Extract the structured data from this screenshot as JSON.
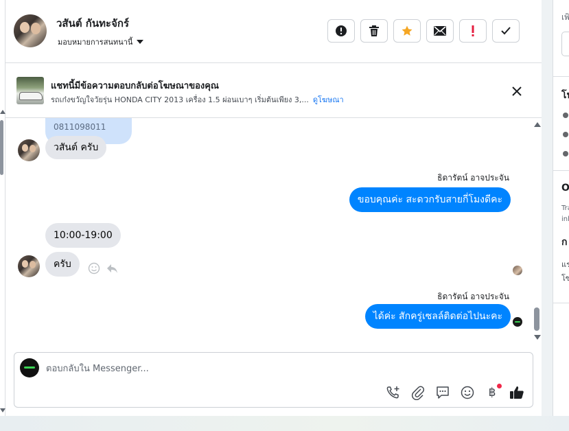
{
  "header": {
    "contact_name": "วสันต์ กันทะจักร์",
    "assign_label": "มอบหมายการสนทนานี้",
    "tools": [
      {
        "name": "spam-button",
        "icon": "alert-circle-icon"
      },
      {
        "name": "delete-button",
        "icon": "trash-icon"
      },
      {
        "name": "star-button",
        "icon": "star-icon",
        "color": "#f5a623"
      },
      {
        "name": "mark-unread-button",
        "icon": "envelope-icon"
      },
      {
        "name": "follow-up-button",
        "icon": "exclamation-icon",
        "color": "#e41e3f"
      },
      {
        "name": "done-button",
        "icon": "check-icon"
      }
    ]
  },
  "ad": {
    "title": "แชทนี้มีข้อความตอบกลับต่อโฆษณาของคุณ",
    "description": "รถเก๋งขวัญใจวัยรุ่น HONDA CITY 2013 เครื่อง 1.5 ผ่อนเบาๆ เริ่มต้นเพียง 3,...",
    "link_label": "ดูโฆษณา"
  },
  "messages": {
    "phone": "0811098011",
    "m1": "วสันต์  ครับ",
    "sender1": "ธิดารัตน์ อาจประจัน",
    "m2": "ขอบคุณค่ะ สะดวกรับสายกี่โมงดีคะ",
    "m3": "10:00-19:00",
    "m4": "ครับ",
    "sender2": "ธิดารัตน์ อาจประจัน",
    "m5": "ได้ค่ะ สักครู่เซลล์ติดต่อไปนะคะ"
  },
  "composer": {
    "placeholder": "ตอบกลับใน Messenger...",
    "tools": [
      "call-add-icon",
      "paperclip-icon",
      "saved-reply-icon",
      "emoji-icon",
      "baht-icon",
      "thumbs-up-icon"
    ],
    "baht_symbol": "฿"
  },
  "right_panel": {
    "t1": "เพิ",
    "t2": "โป",
    "t3": "O",
    "t4": "Tra",
    "t5": "inl",
    "t6": "ก",
    "t7": "แร",
    "t8": "โซ"
  },
  "colors": {
    "accent": "#0084ff",
    "star": "#f5a623",
    "alert": "#e41e3f",
    "link": "#1877f2"
  }
}
